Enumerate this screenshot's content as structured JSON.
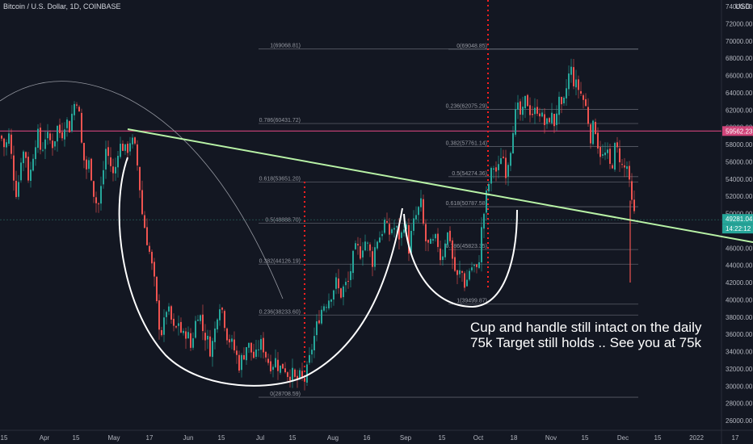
{
  "header": {
    "title": "Bitcoin / U.S. Dollar, 1D, COINBASE",
    "currency": "USD"
  },
  "annotation": {
    "line1": "Cup and handle still intact on the daily",
    "line2": "75k Target still holds .. See you at 75k"
  },
  "colors": {
    "background": "#131722",
    "up_candle": "#26a69a",
    "down_candle": "#ef5350",
    "trendline": "#b8f2a6",
    "resistance_line": "#d0457a",
    "fib_lines": "#787b86",
    "event_lines": "#ff2020",
    "cup_drawing": "#ffffff",
    "arc_drawing": "#9598a1"
  },
  "chart_data": {
    "type": "candlestick",
    "title": "Bitcoin / U.S. Dollar, 1D, COINBASE",
    "ylim": [
      25000,
      74000
    ],
    "y_ticks": [
      26000,
      28000,
      30000,
      32000,
      34000,
      36000,
      38000,
      40000,
      42000,
      44000,
      46000,
      48000,
      50000,
      52000,
      54000,
      56000,
      58000,
      60000,
      62000,
      64000,
      66000,
      68000,
      70000,
      72000,
      74000
    ],
    "x_ticks": [
      "15",
      "Apr",
      "15",
      "May",
      "17",
      "Jun",
      "15",
      "Jul",
      "15",
      "Aug",
      "16",
      "Sep",
      "15",
      "Oct",
      "18",
      "Nov",
      "15",
      "Dec",
      "15",
      "2022",
      "17"
    ],
    "price_badges": [
      {
        "label": "59562.23",
        "value": 59562.23
      },
      {
        "label": "49281.04",
        "value": 49281.04
      },
      {
        "label": "14:22:12",
        "value": 48500
      }
    ],
    "horizontal_line": {
      "value": 59562.23
    },
    "fib_sets": [
      {
        "levels": [
          {
            "label": "1(69068.81)",
            "value": 69068.81
          },
          {
            "label": "0.786(60431.72)",
            "value": 60431.72
          },
          {
            "label": "0.618(53651.20)",
            "value": 53651.2
          },
          {
            "label": "0.5(48888.70)",
            "value": 48888.7
          },
          {
            "label": "0.382(44126.19)",
            "value": 44126.19
          },
          {
            "label": "0.236(38233.60)",
            "value": 38233.6
          },
          {
            "label": "0(28708.59)",
            "value": 28708.59
          }
        ]
      },
      {
        "levels": [
          {
            "label": "0(69048.85)",
            "value": 69048.85
          },
          {
            "label": "0.236(62075.29)",
            "value": 62075.29
          },
          {
            "label": "0.382(57761.14)",
            "value": 57761.14
          },
          {
            "label": "0.5(54274.36)",
            "value": 54274.36
          },
          {
            "label": "0.618(50787.58)",
            "value": 50787.58
          },
          {
            "label": "0.786(45823.35)",
            "value": 45823.35
          },
          {
            "label": "1(39499.87)",
            "value": 39499.87
          }
        ]
      }
    ],
    "price_path": [
      [
        0,
        59000
      ],
      [
        5,
        57500
      ],
      [
        10,
        59000
      ],
      [
        15,
        55000
      ],
      [
        20,
        52000
      ],
      [
        25,
        56500
      ],
      [
        30,
        57500
      ],
      [
        35,
        53500
      ],
      [
        40,
        57000
      ],
      [
        45,
        59500
      ],
      [
        50,
        57000
      ],
      [
        55,
        59000
      ],
      [
        60,
        58500
      ],
      [
        65,
        58000
      ],
      [
        70,
        60000
      ],
      [
        75,
        59000
      ],
      [
        80,
        61000
      ],
      [
        85,
        60000
      ],
      [
        90,
        62500
      ],
      [
        95,
        63500
      ],
      [
        100,
        58000
      ],
      [
        105,
        55000
      ],
      [
        110,
        56000
      ],
      [
        115,
        52500
      ],
      [
        120,
        50500
      ],
      [
        125,
        53500
      ],
      [
        130,
        57500
      ],
      [
        135,
        56000
      ],
      [
        140,
        54000
      ],
      [
        145,
        57500
      ],
      [
        150,
        58000
      ],
      [
        155,
        57000
      ],
      [
        160,
        58500
      ],
      [
        165,
        58000
      ],
      [
        170,
        55000
      ],
      [
        175,
        50000
      ],
      [
        180,
        47500
      ],
      [
        185,
        45000
      ],
      [
        190,
        42000
      ],
      [
        195,
        37500
      ],
      [
        200,
        36000
      ],
      [
        205,
        39000
      ],
      [
        210,
        38000
      ],
      [
        215,
        36000
      ],
      [
        220,
        37500
      ],
      [
        225,
        35500
      ],
      [
        230,
        36500
      ],
      [
        235,
        34500
      ],
      [
        240,
        37000
      ],
      [
        245,
        39000
      ],
      [
        250,
        36500
      ],
      [
        255,
        35500
      ],
      [
        260,
        34000
      ],
      [
        265,
        36500
      ],
      [
        270,
        40000
      ],
      [
        275,
        38500
      ],
      [
        280,
        36000
      ],
      [
        285,
        35000
      ],
      [
        290,
        34000
      ],
      [
        295,
        32500
      ],
      [
        300,
        33500
      ],
      [
        305,
        35000
      ],
      [
        310,
        34000
      ],
      [
        315,
        33000
      ],
      [
        320,
        35000
      ],
      [
        325,
        34500
      ],
      [
        330,
        33000
      ],
      [
        335,
        32500
      ],
      [
        340,
        33000
      ],
      [
        345,
        32000
      ],
      [
        350,
        32500
      ],
      [
        355,
        31500
      ],
      [
        360,
        31500
      ],
      [
        365,
        30500
      ],
      [
        370,
        31000
      ],
      [
        375,
        30500
      ],
      [
        380,
        32000
      ],
      [
        385,
        34500
      ],
      [
        390,
        36500
      ],
      [
        395,
        38500
      ],
      [
        400,
        39500
      ],
      [
        405,
        40000
      ],
      [
        410,
        41000
      ],
      [
        415,
        42000
      ],
      [
        420,
        40500
      ],
      [
        425,
        41500
      ],
      [
        430,
        42000
      ],
      [
        435,
        44500
      ],
      [
        440,
        46000
      ],
      [
        445,
        45500
      ],
      [
        450,
        47000
      ],
      [
        455,
        46000
      ],
      [
        460,
        44500
      ],
      [
        465,
        47000
      ],
      [
        470,
        47500
      ],
      [
        475,
        49000
      ],
      [
        480,
        47500
      ],
      [
        485,
        48500
      ],
      [
        490,
        48000
      ],
      [
        495,
        47000
      ],
      [
        500,
        49500
      ],
      [
        505,
        46000
      ],
      [
        510,
        48500
      ],
      [
        515,
        50000
      ],
      [
        520,
        51000
      ],
      [
        525,
        47000
      ],
      [
        530,
        46000
      ],
      [
        535,
        46500
      ],
      [
        540,
        47000
      ],
      [
        545,
        44500
      ],
      [
        550,
        47000
      ],
      [
        555,
        48000
      ],
      [
        560,
        44000
      ],
      [
        565,
        42500
      ],
      [
        570,
        43500
      ],
      [
        575,
        41500
      ],
      [
        580,
        43500
      ],
      [
        585,
        44000
      ],
      [
        590,
        43000
      ],
      [
        595,
        48000
      ],
      [
        600,
        51500
      ],
      [
        605,
        54000
      ],
      [
        610,
        55500
      ],
      [
        615,
        54500
      ],
      [
        620,
        57500
      ],
      [
        625,
        55000
      ],
      [
        630,
        57000
      ],
      [
        635,
        61000
      ],
      [
        640,
        62000
      ],
      [
        645,
        61000
      ],
      [
        650,
        63500
      ],
      [
        655,
        62000
      ],
      [
        660,
        61500
      ],
      [
        665,
        62500
      ],
      [
        670,
        61000
      ],
      [
        675,
        60000
      ],
      [
        680,
        61500
      ],
      [
        685,
        60500
      ],
      [
        690,
        63000
      ],
      [
        695,
        61500
      ],
      [
        700,
        64500
      ],
      [
        705,
        67000
      ],
      [
        710,
        65000
      ],
      [
        715,
        64500
      ],
      [
        720,
        63500
      ],
      [
        725,
        62000
      ],
      [
        730,
        59000
      ],
      [
        735,
        60500
      ],
      [
        740,
        57500
      ],
      [
        745,
        56500
      ],
      [
        750,
        57000
      ],
      [
        755,
        55000
      ],
      [
        760,
        57500
      ],
      [
        765,
        57000
      ],
      [
        770,
        55000
      ],
      [
        775,
        55500
      ],
      [
        780,
        51500
      ],
      [
        785,
        49300
      ]
    ]
  }
}
